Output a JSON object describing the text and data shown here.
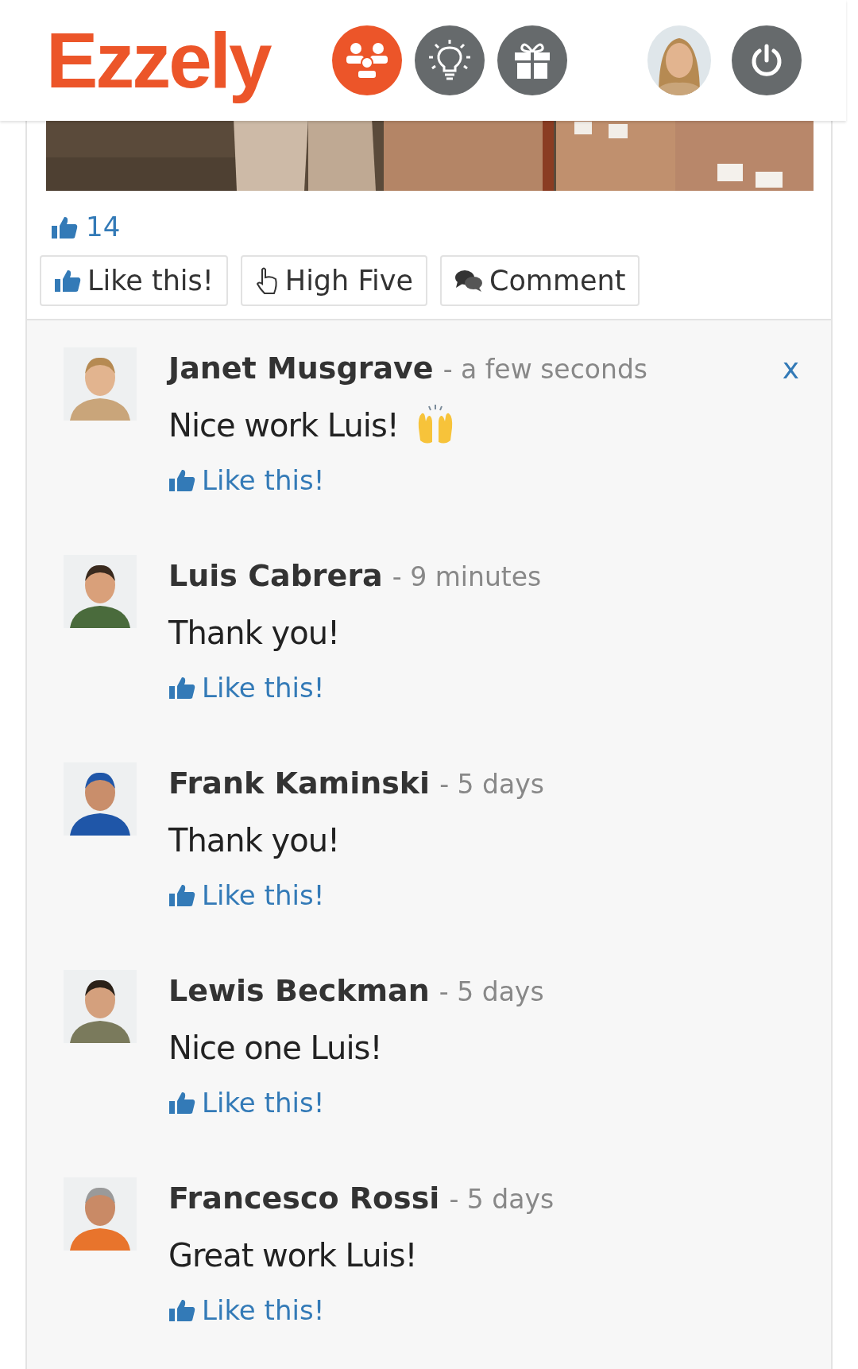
{
  "header": {
    "logo": "Ezzely",
    "nav_icons": [
      {
        "kind": "team",
        "selected": true
      },
      {
        "kind": "idea",
        "selected": false
      },
      {
        "kind": "gift",
        "selected": false
      }
    ]
  },
  "post": {
    "likes_count": "14",
    "actions": [
      {
        "kind": "like",
        "label": "Like this!"
      },
      {
        "kind": "high_five",
        "label": "High Five"
      },
      {
        "kind": "comment",
        "label": "Comment"
      }
    ]
  },
  "comments": [
    {
      "name": "Janet Musgrave",
      "time": "- a few seconds",
      "text": "Nice work Luis!",
      "raised_hands": true,
      "delete": "x",
      "like": "Like this!"
    },
    {
      "name": "Luis Cabrera",
      "time": "- 9 minutes",
      "text": "Thank you!",
      "raised_hands": false,
      "like": "Like this!"
    },
    {
      "name": "Frank Kaminski",
      "time": "- 5 days",
      "text": "Thank you!",
      "raised_hands": false,
      "like": "Like this!"
    },
    {
      "name": "Lewis Beckman",
      "time": "- 5 days",
      "text": "Nice one Luis!",
      "raised_hands": false,
      "like": "Like this!"
    },
    {
      "name": "Francesco Rossi",
      "time": "- 5 days",
      "text": "Great work Luis!",
      "raised_hands": false,
      "like": "Like this!"
    }
  ]
}
